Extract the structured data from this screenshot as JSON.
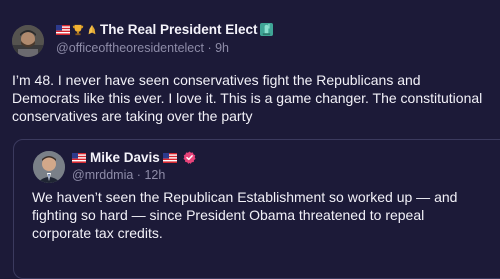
{
  "post": {
    "author_name": "The Real President Elect",
    "author_emojis": [
      "us-flag-emoji",
      "trophy-emoji",
      "praying-hands-emoji",
      "statue-of-liberty-emoji"
    ],
    "handle": "@officeoftheoresidentelect",
    "separator": "·",
    "time": "9h",
    "text": "I’m 48. I never have seen conservatives fight the Republicans and Democrats like this ever. I love it. This is a game changer. The constitutional conservatives are taking over the party"
  },
  "quote": {
    "author_name": "Mike Davis",
    "handle": "@mrddmia",
    "separator": "·",
    "time": "12h",
    "text": "We haven’t seen the Republican Establishment so worked up — and fighting so hard — since President Obama threatened to repeal corporate tax credits."
  },
  "colors": {
    "background": "#1c1a38",
    "text": "#f2f1f8",
    "muted": "#8e8ca8",
    "card_border": "#3b3a5e",
    "verified": "#e8437a"
  }
}
